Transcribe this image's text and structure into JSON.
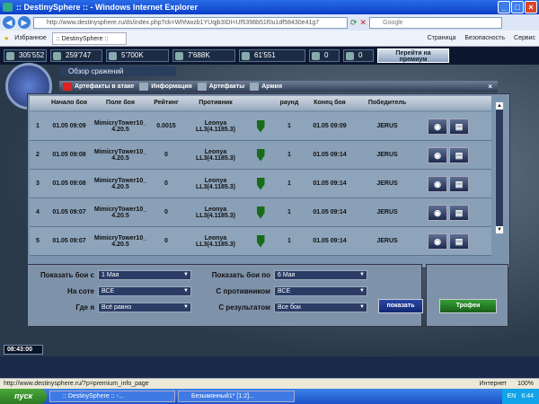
{
  "window": {
    "title": ":: DestinySphere :: - Windows Internet Explorer"
  },
  "address_bar": {
    "url": "http://www.destinysphere.ru/ds/index.php?ck=WhNwzb1YUqjb3IDI=Uf5398b51f0u1df58430e41g7",
    "search_placeholder": "Google"
  },
  "favorites_bar": {
    "favorites_label": "Избранное",
    "tab_label": ":: DestinySphere ::",
    "tools": [
      "Страница",
      "Безопасность",
      "Сервис"
    ]
  },
  "resources": [
    "305'552",
    "259'747",
    "5'700K",
    "7'688K",
    "61'551",
    "0",
    "0"
  ],
  "premium_button": "Перейти на премиум",
  "window_title": "Обзор сражений",
  "tabs": [
    "Артефакты в атаке",
    "Информация",
    "Артефакты",
    "Армия"
  ],
  "table": {
    "headers": [
      "",
      "Начало боя",
      "Поле боя",
      "Рейтинг",
      "Противник",
      "",
      "раунд",
      "Конец боя",
      "Победитель",
      ""
    ],
    "rows": [
      {
        "num": "1",
        "start": "01.05 09:09",
        "field_line1": "MimicryTower10_",
        "field_line2": "4.20.5",
        "rating": "0.0015",
        "opp_line1": "Leonya",
        "opp_line2": "LL3(4.1185.3)",
        "round": "1",
        "end": "01.05 09:09",
        "winner": "JERUS"
      },
      {
        "num": "2",
        "start": "01.05 09:08",
        "field_line1": "MimicryTower10_",
        "field_line2": "4.20.5",
        "rating": "0",
        "opp_line1": "Leonya",
        "opp_line2": "LL3(4.1185.3)",
        "round": "1",
        "end": "01.05 09:14",
        "winner": "JERUS"
      },
      {
        "num": "3",
        "start": "01.05 09:08",
        "field_line1": "MimicryTower10_",
        "field_line2": "4.20.5",
        "rating": "0",
        "opp_line1": "Leonya",
        "opp_line2": "LL3(4.1185.3)",
        "round": "1",
        "end": "01.05 09:14",
        "winner": "JERUS"
      },
      {
        "num": "4",
        "start": "01.05 09:07",
        "field_line1": "MimicryTower10_",
        "field_line2": "4.20.5",
        "rating": "0",
        "opp_line1": "Leonya",
        "opp_line2": "LL3(4.1185.3)",
        "round": "1",
        "end": "01.05 09:14",
        "winner": "JERUS"
      },
      {
        "num": "5",
        "start": "01.05 09:07",
        "field_line1": "MimicryTower10_",
        "field_line2": "4.20.5",
        "rating": "0",
        "opp_line1": "Leonya",
        "opp_line2": "LL3(4.1185.3)",
        "round": "1",
        "end": "01.05 09:14",
        "winner": "JERUS"
      }
    ]
  },
  "filters": {
    "from_label": "Показать бои с",
    "from_value": "1 Мая",
    "to_label": "Показать бои по",
    "to_value": "6 Мая",
    "honeycomb_label": "На соте",
    "honeycomb_value": "ВСЕ",
    "opponent_label": "С противником",
    "opponent_value": "ВСЕ",
    "where_label": "Где я",
    "where_value": "Всё равно",
    "result_label": "С результатом",
    "result_value": "Все бои",
    "show_button": "показать"
  },
  "trophy_button": "Трофеи",
  "game_time": "08:43:00",
  "status": {
    "url": "http://www.destinysphere.ru/?p=premium_info_page",
    "zone": "Интернет",
    "zoom": "100%"
  },
  "taskbar": {
    "start": "пуск",
    "tasks": [
      ":: DestinySphere :: -...",
      "Безымянный1* [1:2]..."
    ],
    "lang": "EN",
    "clock": "6:44"
  }
}
